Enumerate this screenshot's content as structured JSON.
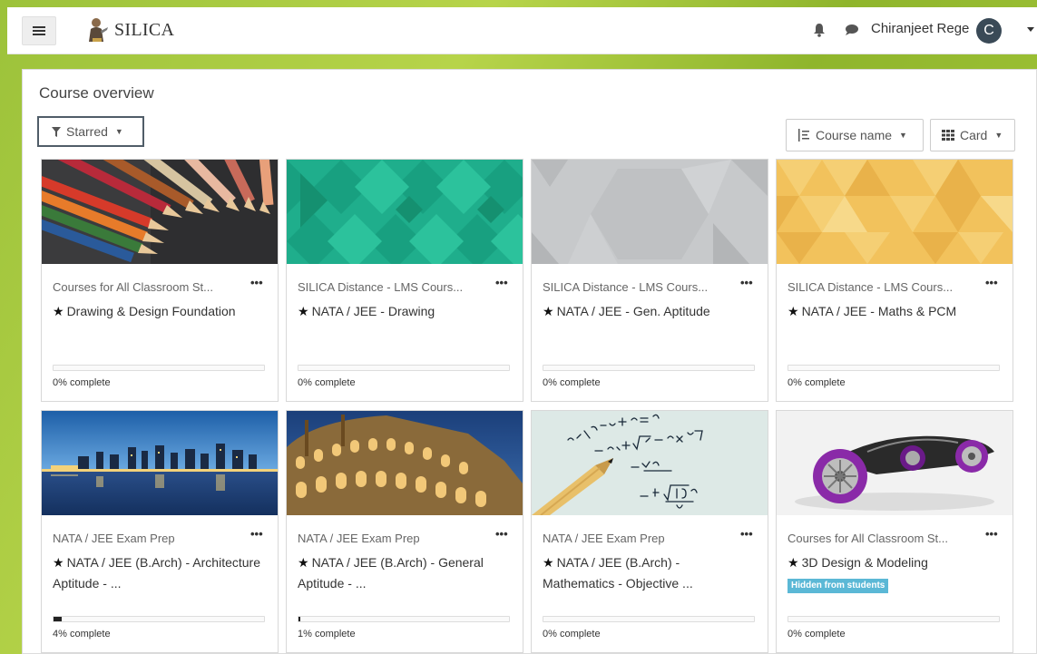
{
  "navbar": {
    "brand": "SILICA",
    "username": "Chiranjeet Rege",
    "avatar_letter": "C"
  },
  "overview": {
    "title": "Course overview",
    "filter_label": "Starred",
    "sort_label": "Course name",
    "view_label": "Card"
  },
  "courses": [
    {
      "category": "Courses for All Classroom St...",
      "title": "Drawing & Design Foundation",
      "progress": 0,
      "progress_text": "0% complete",
      "image": "pencils-photo"
    },
    {
      "category": "SILICA Distance - LMS Cours...",
      "title": "NATA / JEE - Drawing",
      "progress": 0,
      "progress_text": "0% complete",
      "image": "teal-diamond-pattern"
    },
    {
      "category": "SILICA Distance - LMS Cours...",
      "title": "NATA / JEE - Gen. Aptitude",
      "progress": 0,
      "progress_text": "0% complete",
      "image": "grey-hexagon-pattern"
    },
    {
      "category": "SILICA Distance - LMS Cours...",
      "title": "NATA / JEE - Maths & PCM",
      "progress": 0,
      "progress_text": "0% complete",
      "image": "yellow-triangle-pattern"
    },
    {
      "category": "NATA / JEE Exam Prep",
      "title": "NATA / JEE (B.Arch) - Architecture Aptitude - ...",
      "progress": 4,
      "progress_text": "4% complete",
      "image": "city-skyline-photo"
    },
    {
      "category": "NATA / JEE Exam Prep",
      "title": "NATA / JEE (B.Arch) - General Aptitude - ...",
      "progress": 1,
      "progress_text": "1% complete",
      "image": "colosseum-photo"
    },
    {
      "category": "NATA / JEE Exam Prep",
      "title": "NATA / JEE (B.Arch) - Mathematics - Objective ...",
      "progress": 0,
      "progress_text": "0% complete",
      "image": "math-formula-photo"
    },
    {
      "category": "Courses for All Classroom St...",
      "title": "3D Design & Modeling",
      "badge": "Hidden from students",
      "progress": 0,
      "progress_text": "0% complete",
      "image": "3d-car-render"
    }
  ],
  "colors": {
    "background_green": "#9cc23a",
    "filter_border": "#505d68",
    "badge_blue": "#5bb8d6",
    "avatar_bg": "#3a4a57"
  }
}
